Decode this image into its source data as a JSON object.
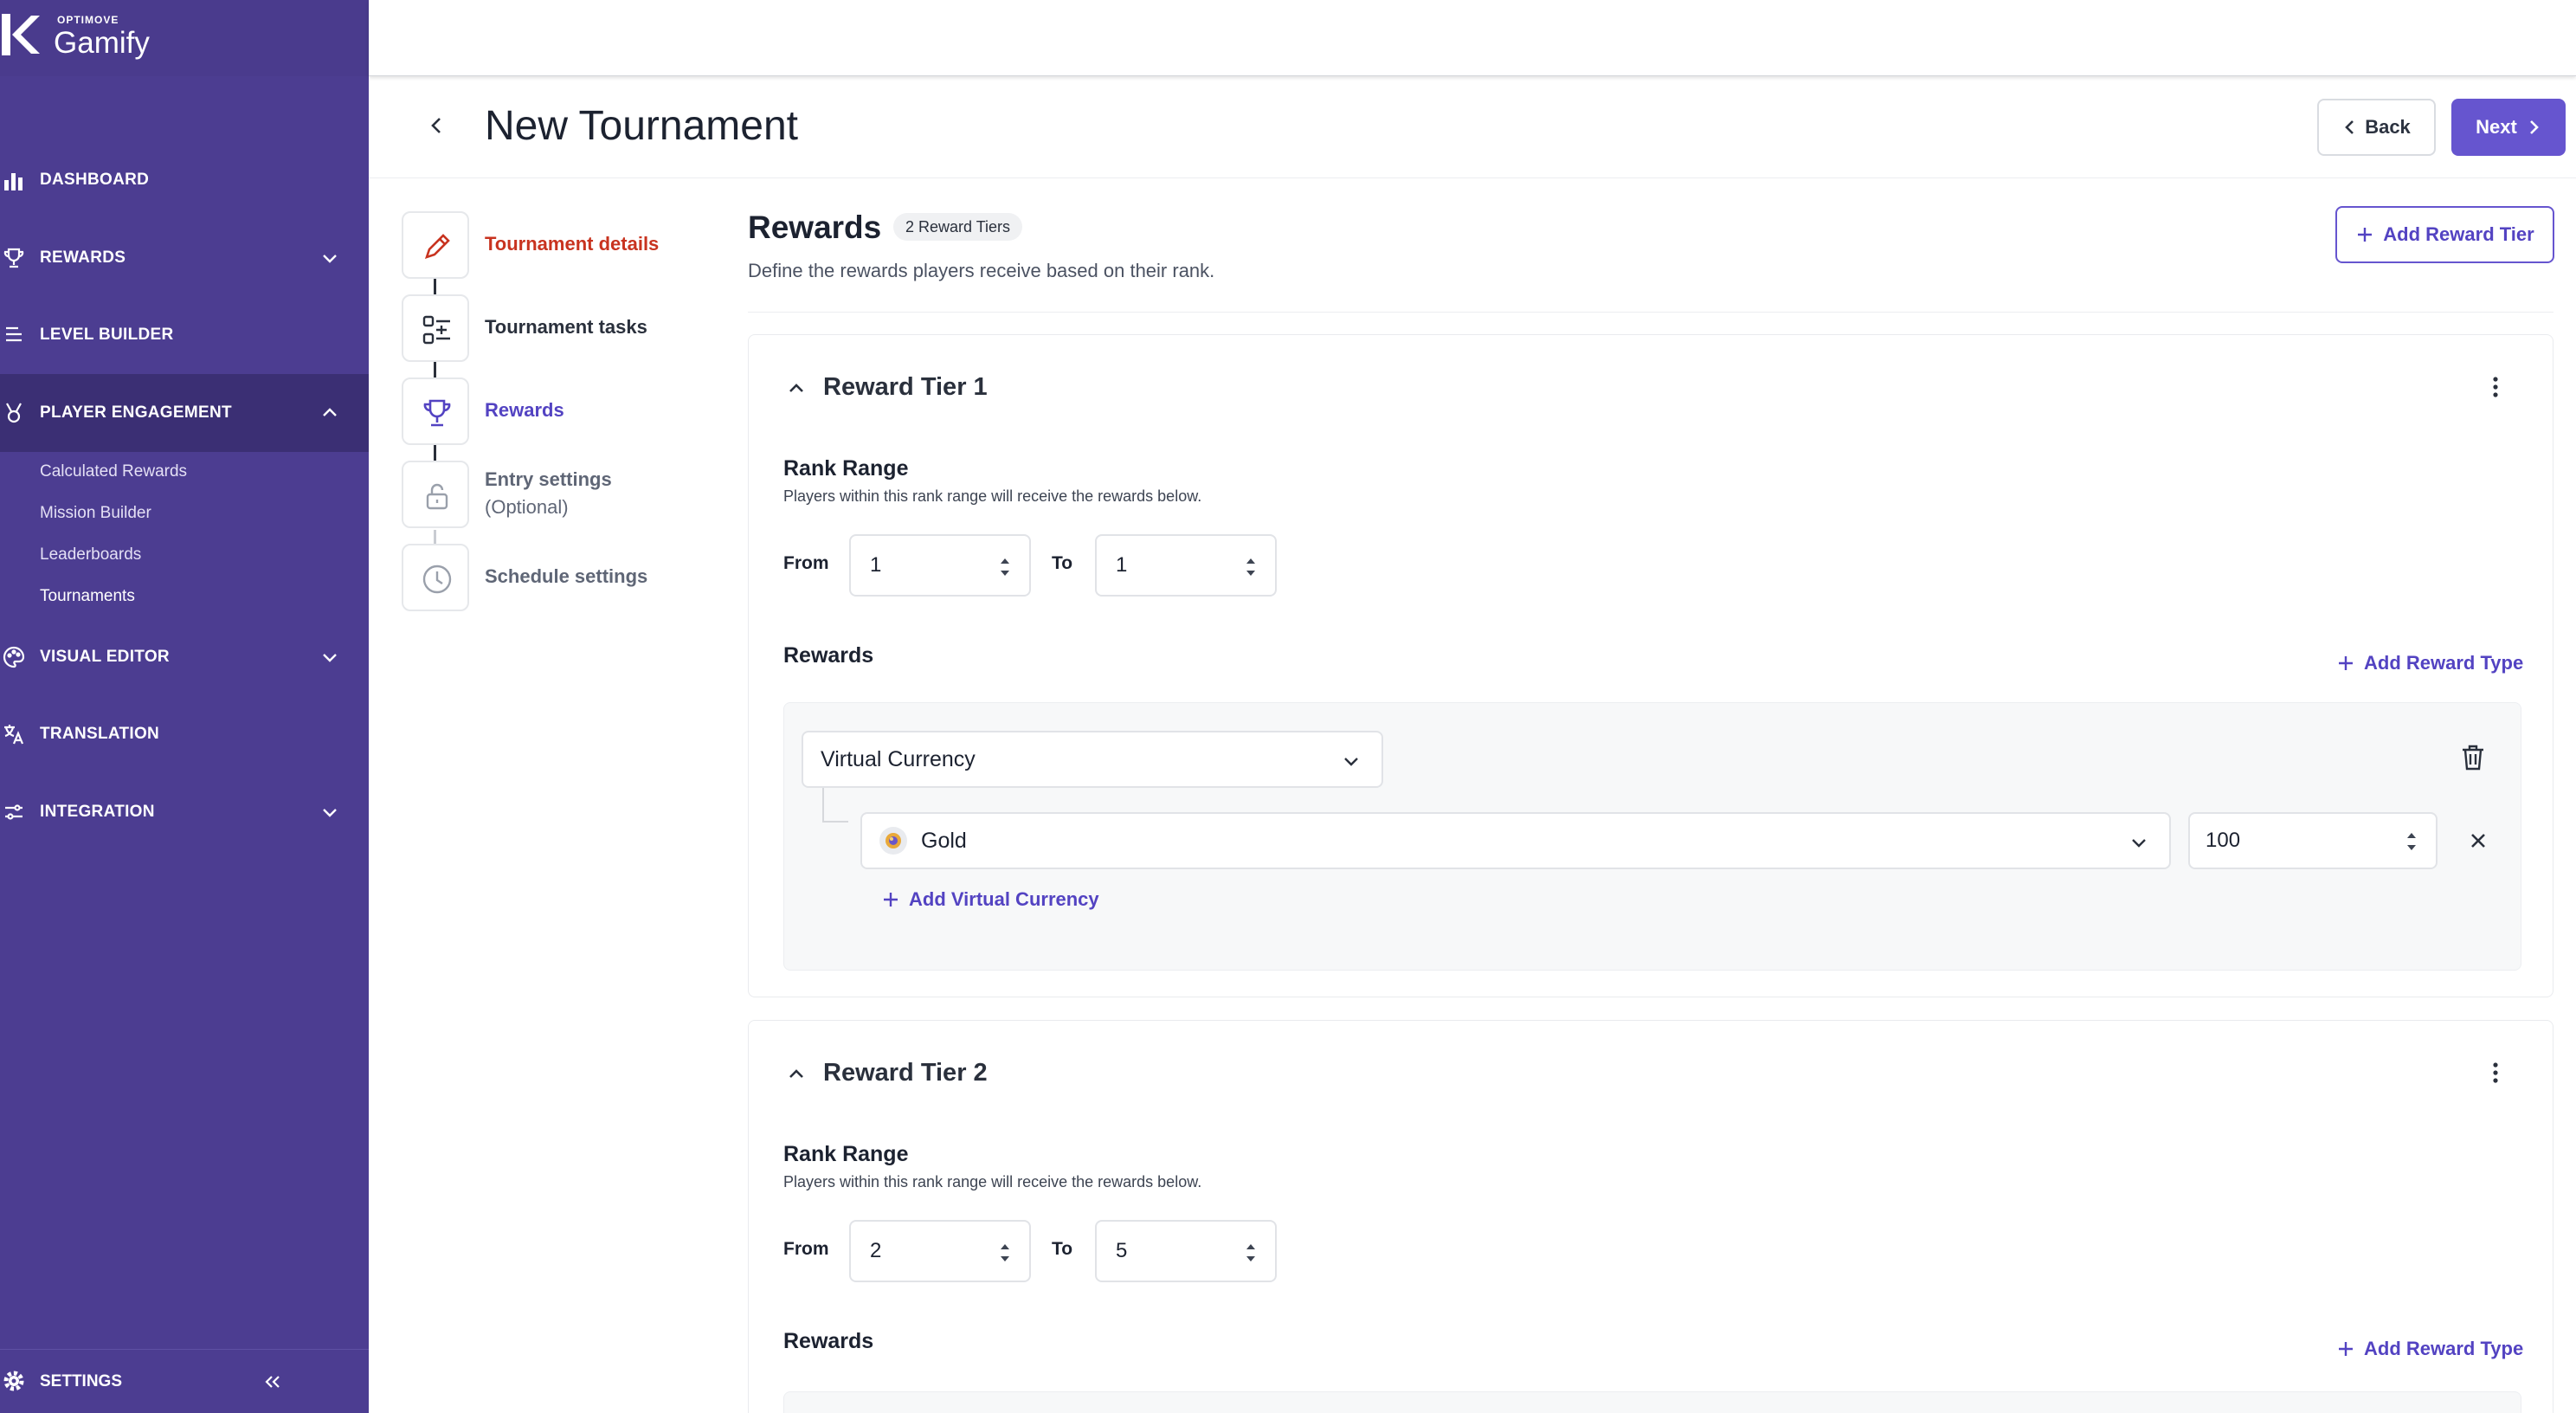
{
  "brand": {
    "small": "OPTIMOVE",
    "name": "Gamify"
  },
  "sidebar": {
    "items": [
      {
        "label": "DASHBOARD"
      },
      {
        "label": "REWARDS"
      },
      {
        "label": "LEVEL BUILDER"
      },
      {
        "label": "PLAYER ENGAGEMENT"
      },
      {
        "label": "VISUAL EDITOR"
      },
      {
        "label": "TRANSLATION"
      },
      {
        "label": "INTEGRATION"
      }
    ],
    "sub_items": [
      {
        "label": "Calculated Rewards"
      },
      {
        "label": "Mission Builder"
      },
      {
        "label": "Leaderboards"
      },
      {
        "label": "Tournaments"
      }
    ],
    "settings_label": "SETTINGS"
  },
  "header": {
    "title": "New Tournament",
    "back_label": "Back",
    "next_label": "Next"
  },
  "steps": [
    {
      "label": "Tournament details",
      "color": "#c8331f"
    },
    {
      "label": "Tournament tasks",
      "color": "#2a303c"
    },
    {
      "label": "Rewards",
      "color": "#5343c2"
    },
    {
      "label": "Entry settings",
      "sub": "(Optional)",
      "color": "#5f6676"
    },
    {
      "label": "Schedule settings",
      "color": "#5f6676"
    }
  ],
  "rewards": {
    "title": "Rewards",
    "badge": "2 Reward Tiers",
    "description": "Define the rewards players receive based on their rank.",
    "add_tier_label": "Add Reward Tier"
  },
  "tiers": [
    {
      "title": "Reward Tier 1",
      "rank_range_title": "Rank Range",
      "rank_range_desc": "Players within this rank range will receive the rewards below.",
      "from_label": "From",
      "from_value": "1",
      "to_label": "To",
      "to_value": "1",
      "rewards_title": "Rewards",
      "add_reward_type": "Add Reward Type",
      "reward_type": "Virtual Currency",
      "currency": "Gold",
      "amount": "100",
      "add_vc": "Add Virtual Currency"
    },
    {
      "title": "Reward Tier 2",
      "rank_range_title": "Rank Range",
      "rank_range_desc": "Players within this rank range will receive the rewards below.",
      "from_label": "From",
      "from_value": "2",
      "to_label": "To",
      "to_value": "5",
      "rewards_title": "Rewards",
      "add_reward_type": "Add Reward Type"
    }
  ],
  "colors": {
    "sidebar": "#4c3d91",
    "accent": "#6655cf",
    "active_step": "#c8331f"
  }
}
